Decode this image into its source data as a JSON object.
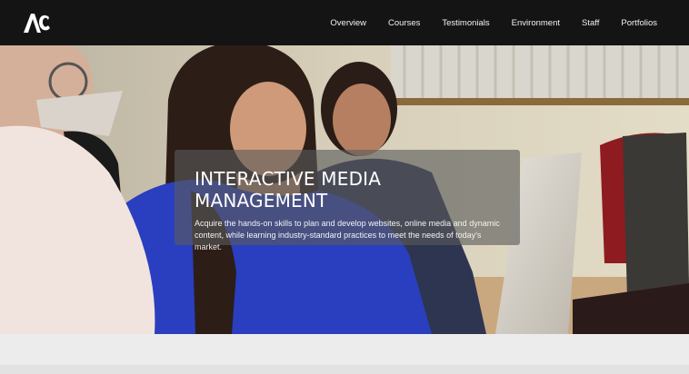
{
  "brand": {
    "logo_text": "AC"
  },
  "nav": {
    "items": [
      {
        "label": "Overview"
      },
      {
        "label": "Courses"
      },
      {
        "label": "Testimonials"
      },
      {
        "label": "Environment"
      },
      {
        "label": "Staff"
      },
      {
        "label": "Portfolios"
      }
    ]
  },
  "hero": {
    "title": "INTERACTIVE MEDIA MANAGEMENT",
    "description": "Acquire the hands-on skills to plan and develop websites, online media and dynamic content, while learning industry-standard practices to meet the needs of today's market."
  },
  "colors": {
    "topbar": "#141414",
    "nav_text": "#f2f2f2",
    "overlay": "rgba(90,90,90,0.62)",
    "sweater_blue": "#2a3fbf"
  }
}
